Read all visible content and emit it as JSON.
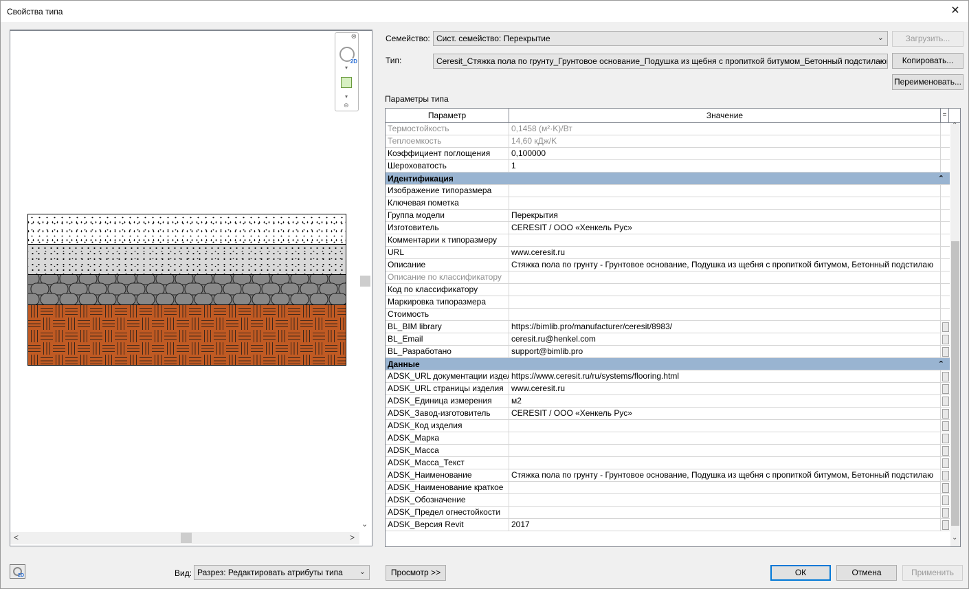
{
  "window": {
    "title": "Свойства типа",
    "close_glyph": "✕"
  },
  "preview": {
    "nav_close": "⊗",
    "nav_wheel_badge": "2D",
    "nav_min": "⊖",
    "hscroll_left": "<",
    "hscroll_right": ">",
    "vscroll_up": "⌃",
    "vscroll_down": "⌄",
    "layer_colors": {
      "fill1": "#ffffff",
      "fill2": "#d9d9d9",
      "gravel": "#808080",
      "brick": "#c05a23"
    }
  },
  "family": {
    "label": "Семейство:",
    "value": "Сист. семейство: Перекрытие",
    "load_button": "Загрузить..."
  },
  "type": {
    "label": "Тип:",
    "value": "Ceresit_Стяжка пола по грунту_Грунтовое основание_Подушка из щебня с пропиткой битумом_Бетонный подстилающий сл",
    "duplicate_button": "Копировать...",
    "rename_button": "Переименовать..."
  },
  "type_params": {
    "caption": "Параметры типа",
    "header": {
      "param": "Параметр",
      "value": "Значение",
      "extra": "="
    },
    "top_rows": [
      {
        "name": "Термостойкость",
        "value": "0,1458 (м²·K)/Вт",
        "gray": true,
        "box": false
      },
      {
        "name": "Теплоемкость",
        "value": "14,60 кДж/K",
        "gray": true,
        "box": false
      },
      {
        "name": "Коэффициент поглощения",
        "value": "0,100000",
        "gray": false,
        "box": false
      },
      {
        "name": "Шероховатость",
        "value": "1",
        "gray": false,
        "box": false
      }
    ],
    "group_ident": {
      "title": "Идентификация",
      "collapse": "⌃",
      "rows": [
        {
          "name": "Изображение типоразмера",
          "value": "",
          "gray": false,
          "box": false
        },
        {
          "name": "Ключевая пометка",
          "value": "",
          "gray": false,
          "box": false
        },
        {
          "name": "Группа модели",
          "value": "Перекрытия",
          "gray": false,
          "box": false
        },
        {
          "name": "Изготовитель",
          "value": "CERESIT / ООО «Хенкель Рус»",
          "gray": false,
          "box": false
        },
        {
          "name": "Комментарии к типоразмеру",
          "value": "",
          "gray": false,
          "box": false
        },
        {
          "name": "URL",
          "value": "www.ceresit.ru",
          "gray": false,
          "box": false
        },
        {
          "name": "Описание",
          "value": "Стяжка пола по грунту - Грунтовое основание, Подушка из щебня с пропиткой битумом, Бетонный подстилаю",
          "gray": false,
          "box": false
        },
        {
          "name": "Описание по классификатору",
          "value": "",
          "gray": true,
          "box": false
        },
        {
          "name": "Код по классификатору",
          "value": "",
          "gray": false,
          "box": false
        },
        {
          "name": "Маркировка типоразмера",
          "value": "",
          "gray": false,
          "box": false
        },
        {
          "name": "Стоимость",
          "value": "",
          "gray": false,
          "box": false
        },
        {
          "name": "BL_BIM library",
          "value": "https://bimlib.pro/manufacturer/ceresit/8983/",
          "gray": false,
          "box": true
        },
        {
          "name": "BL_Email",
          "value": "ceresit.ru@henkel.com",
          "gray": false,
          "box": true
        },
        {
          "name": "BL_Разработано",
          "value": "support@bimlib.pro",
          "gray": false,
          "box": true
        }
      ]
    },
    "group_data": {
      "title": "Данные",
      "collapse": "⌃",
      "rows": [
        {
          "name": "ADSK_URL документации издел",
          "value": "https://www.ceresit.ru/ru/systems/flooring.html",
          "gray": false,
          "box": true
        },
        {
          "name": "ADSK_URL страницы изделия",
          "value": "www.ceresit.ru",
          "gray": false,
          "box": true
        },
        {
          "name": "ADSK_Единица измерения",
          "value": "м2",
          "gray": false,
          "box": true
        },
        {
          "name": "ADSK_Завод-изготовитель",
          "value": "CERESIT / ООО «Хенкель Рус»",
          "gray": false,
          "box": true
        },
        {
          "name": "ADSK_Код изделия",
          "value": "",
          "gray": false,
          "box": true
        },
        {
          "name": "ADSK_Марка",
          "value": "",
          "gray": false,
          "box": true
        },
        {
          "name": "ADSK_Масса",
          "value": "",
          "gray": false,
          "box": true
        },
        {
          "name": "ADSK_Масса_Текст",
          "value": "",
          "gray": false,
          "box": true
        },
        {
          "name": "ADSK_Наименование",
          "value": "Стяжка пола по грунту - Грунтовое основание, Подушка из щебня с пропиткой битумом, Бетонный подстилаю",
          "gray": false,
          "box": true
        },
        {
          "name": "ADSK_Наименование краткое",
          "value": "",
          "gray": false,
          "box": true
        },
        {
          "name": "ADSK_Обозначение",
          "value": "",
          "gray": false,
          "box": true
        },
        {
          "name": "ADSK_Предел огнестойкости",
          "value": "",
          "gray": false,
          "box": true
        },
        {
          "name": "ADSK_Версия Revit",
          "value": "2017",
          "gray": false,
          "box": true
        }
      ]
    },
    "scroll_up": "⌃",
    "scroll_down": "⌄"
  },
  "footer": {
    "icon_badge": "2D",
    "view_label": "Вид:",
    "view_value": "Разрез: Редактировать атрибуты типа",
    "preview_button": "Просмотр >>",
    "ok_button": "ОК",
    "cancel_button": "Отмена",
    "apply_button": "Применить"
  }
}
